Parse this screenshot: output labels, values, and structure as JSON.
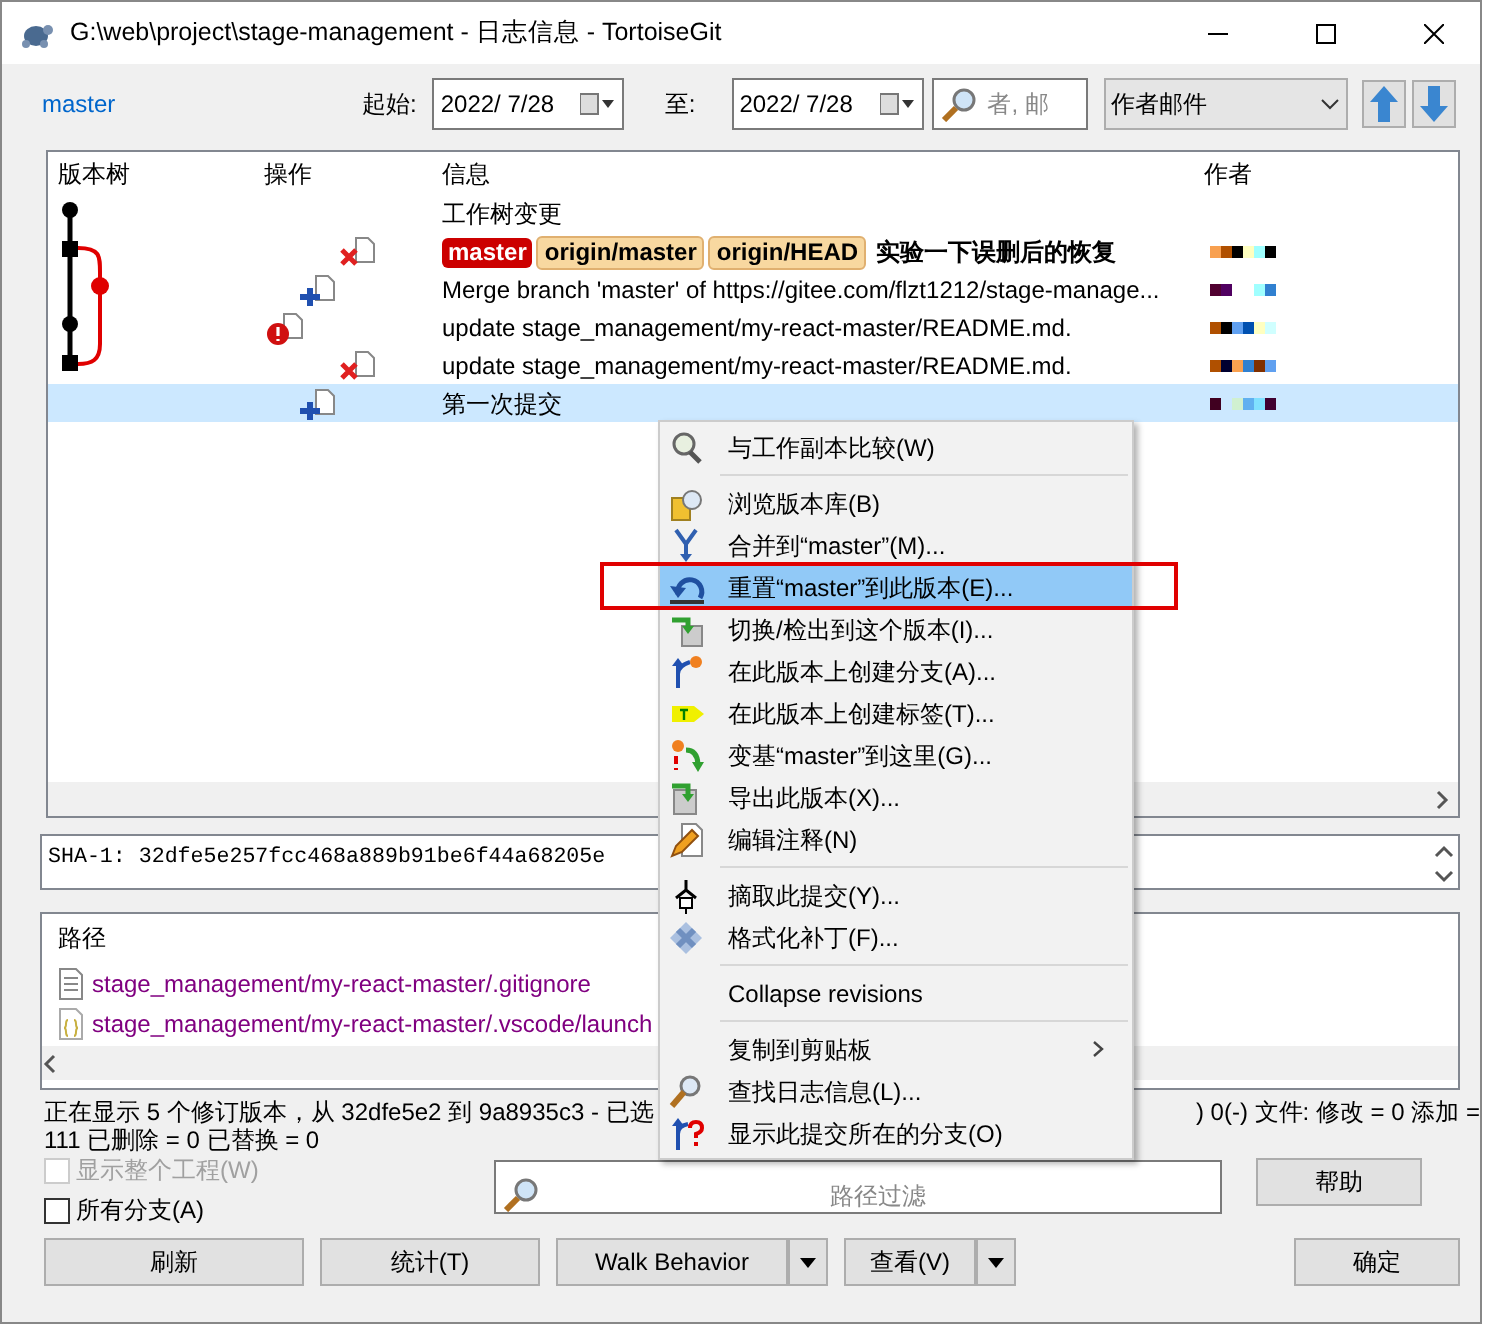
{
  "window": {
    "title": "G:\\web\\project\\stage-management - 日志信息 - TortoiseGit"
  },
  "toolbar": {
    "branch": "master",
    "from_label": "起始:",
    "from_date": "2022/  7/28",
    "to_label": "至:",
    "to_date": "2022/  7/28",
    "search": {
      "placeholder": "者, 邮"
    },
    "filter_by": "作者邮件"
  },
  "log": {
    "columns": [
      "版本树",
      "操作",
      "信息",
      "作者"
    ],
    "rows": [
      {
        "kind": "worktree",
        "refs": [],
        "message": "工作树变更",
        "selected": false
      },
      {
        "kind": "deleted",
        "refs": [
          {
            "label": "master",
            "kind": "local"
          },
          {
            "label": "origin/master",
            "kind": "remote"
          },
          {
            "label": "origin/HEAD",
            "kind": "remote"
          }
        ],
        "message": "实验一下误删后的恢复",
        "selected": false
      },
      {
        "kind": "added",
        "refs": [],
        "message": "Merge branch 'master' of https://gitee.com/flzt1212/stage-manage...",
        "selected": false
      },
      {
        "kind": "conflict",
        "refs": [],
        "message": "update stage_management/my-react-master/README.md.",
        "selected": false
      },
      {
        "kind": "deleted",
        "refs": [],
        "message": "update stage_management/my-react-master/README.md.",
        "selected": false
      },
      {
        "kind": "added",
        "refs": [],
        "message": "第一次提交",
        "selected": true
      }
    ]
  },
  "sha": "SHA-1: 32dfe5e257fcc468a889b91be6f44a68205e",
  "paths": {
    "header": "路径",
    "files": [
      {
        "path": "stage_management/my-react-master/.gitignore",
        "kind": "text"
      },
      {
        "path": "stage_management/my-react-master/.vscode/launch",
        "kind": "json"
      }
    ]
  },
  "status": {
    "line_left": "正在显示 5 个修订版本，从 32dfe5e2 到 9a8935c3 - 已选",
    "line_right": ") 0(-) 文件: 修改 = 0 添加 =",
    "line_2": "111 已删除 = 0 已替换 = 0"
  },
  "options": [
    {
      "label": "显示整个工程(W)",
      "checked": false,
      "disabled": true
    },
    {
      "label": "所有分支(A)",
      "checked": false,
      "disabled": false
    }
  ],
  "path_filter": {
    "placeholder": "路径过滤"
  },
  "buttons": [
    {
      "label": "刷新",
      "dropdown": false
    },
    {
      "label": "统计(T)",
      "dropdown": false
    },
    {
      "label": "Walk Behavior",
      "dropdown": true
    },
    {
      "label": "查看(V)",
      "dropdown": true
    }
  ],
  "help_button": "帮助",
  "ok_button": "确定",
  "context_menu": [
    {
      "kind": "item",
      "label": "与工作副本比较(W)",
      "selected": false,
      "submenu": false
    },
    {
      "kind": "separator"
    },
    {
      "kind": "item",
      "label": "浏览版本库(B)",
      "selected": false,
      "submenu": false
    },
    {
      "kind": "item",
      "label": "合并到“master”(M)...",
      "selected": false,
      "submenu": false
    },
    {
      "kind": "item",
      "label": "重置“master”到此版本(E)...",
      "selected": true,
      "submenu": false
    },
    {
      "kind": "item",
      "label": "切换/检出到这个版本(I)...",
      "selected": false,
      "submenu": false
    },
    {
      "kind": "item",
      "label": "在此版本上创建分支(A)...",
      "selected": false,
      "submenu": false
    },
    {
      "kind": "item",
      "label": "在此版本上创建标签(T)...",
      "selected": false,
      "submenu": false
    },
    {
      "kind": "item",
      "label": "变基“master”到这里(G)...",
      "selected": false,
      "submenu": false
    },
    {
      "kind": "item",
      "label": "导出此版本(X)...",
      "selected": false,
      "submenu": false
    },
    {
      "kind": "item",
      "label": "编辑注释(N)",
      "selected": false,
      "submenu": false
    },
    {
      "kind": "separator"
    },
    {
      "kind": "item",
      "label": "摘取此提交(Y)...",
      "selected": false,
      "submenu": false
    },
    {
      "kind": "item",
      "label": "格式化补丁(F)...",
      "selected": false,
      "submenu": false
    },
    {
      "kind": "separator"
    },
    {
      "kind": "item",
      "label": "Collapse revisions",
      "selected": false,
      "submenu": false
    },
    {
      "kind": "separator"
    },
    {
      "kind": "item",
      "label": "复制到剪贴板",
      "selected": false,
      "submenu": true
    },
    {
      "kind": "item",
      "label": "查找日志信息(L)...",
      "selected": false,
      "submenu": false
    },
    {
      "kind": "item",
      "label": "显示此提交所在的分支(O)",
      "selected": false,
      "submenu": false
    }
  ]
}
